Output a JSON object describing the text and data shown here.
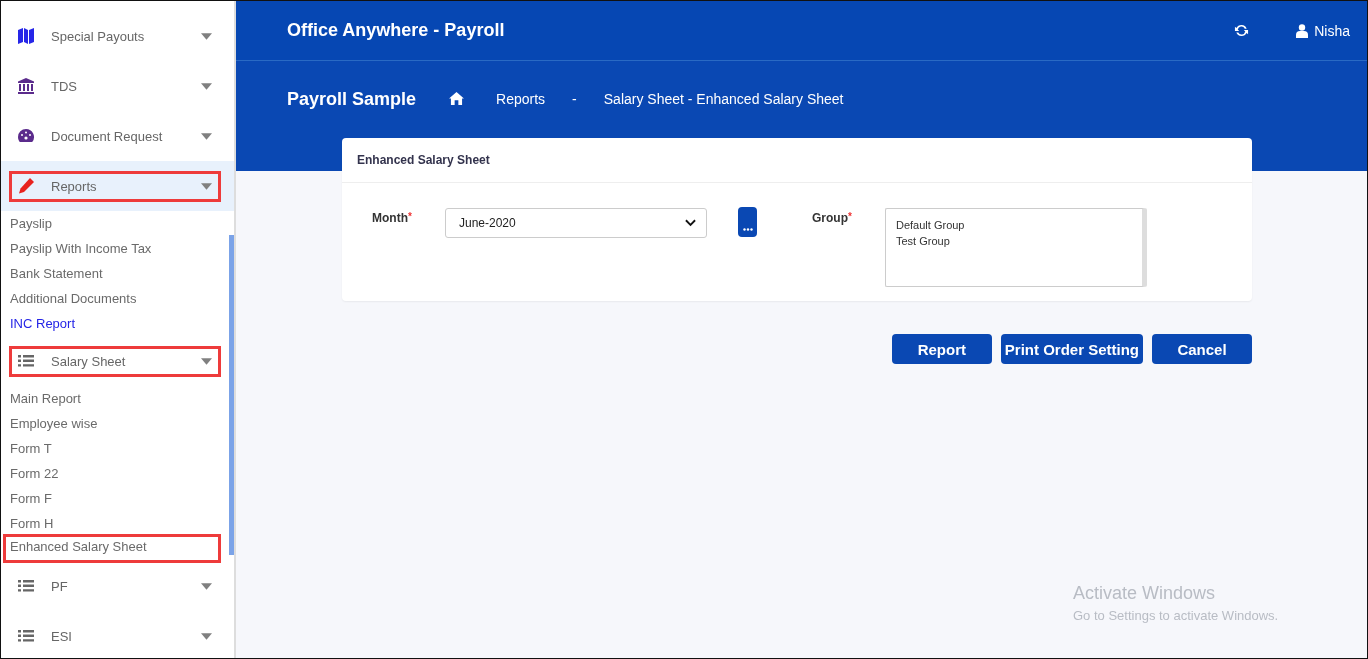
{
  "sidebar": {
    "groups": [
      {
        "label": "Special Payouts",
        "active": false,
        "highlighted": false
      },
      {
        "label": "TDS",
        "active": false,
        "highlighted": false
      },
      {
        "label": "Document Request",
        "active": false,
        "highlighted": false
      },
      {
        "label": "Reports",
        "active": true,
        "highlighted": true,
        "items": [
          {
            "label": "Payslip",
            "selected": false,
            "highlighted": false
          },
          {
            "label": "Payslip With Income Tax",
            "selected": false,
            "highlighted": false
          },
          {
            "label": "Bank Statement",
            "selected": false,
            "highlighted": false
          },
          {
            "label": "Additional Documents",
            "selected": false,
            "highlighted": false
          },
          {
            "label": "INC Report",
            "selected": true,
            "highlighted": false
          }
        ]
      },
      {
        "label": "Salary Sheet",
        "active": false,
        "highlighted": true,
        "items": [
          {
            "label": "Main Report",
            "selected": false,
            "highlighted": false
          },
          {
            "label": "Employee wise",
            "selected": false,
            "highlighted": false
          },
          {
            "label": "Form T",
            "selected": false,
            "highlighted": false
          },
          {
            "label": "Form 22",
            "selected": false,
            "highlighted": false
          },
          {
            "label": "Form F",
            "selected": false,
            "highlighted": false
          },
          {
            "label": "Form H",
            "selected": false,
            "highlighted": false
          },
          {
            "label": "Enhanced Salary Sheet",
            "selected": false,
            "highlighted": true
          }
        ]
      },
      {
        "label": "PF",
        "active": false,
        "highlighted": false
      },
      {
        "label": "ESI",
        "active": false,
        "highlighted": false
      }
    ]
  },
  "header": {
    "title": "Office Anywhere - Payroll",
    "user": "Nisha"
  },
  "breadcrumb": {
    "company": "Payroll Sample",
    "items": [
      "Reports",
      "-",
      "Salary Sheet - Enhanced Salary Sheet"
    ]
  },
  "card": {
    "title": "Enhanced Salary Sheet",
    "month": {
      "label": "Month",
      "required_mark": "*",
      "value": "June-2020"
    },
    "group": {
      "label": "Group",
      "required_mark": "*",
      "options": [
        "Default Group",
        "Test Group"
      ]
    }
  },
  "buttons": [
    "Report",
    "Print Order Setting",
    "Cancel"
  ],
  "os_notice": {
    "title": "Activate Windows",
    "text": "Go to Settings to activate Windows."
  }
}
